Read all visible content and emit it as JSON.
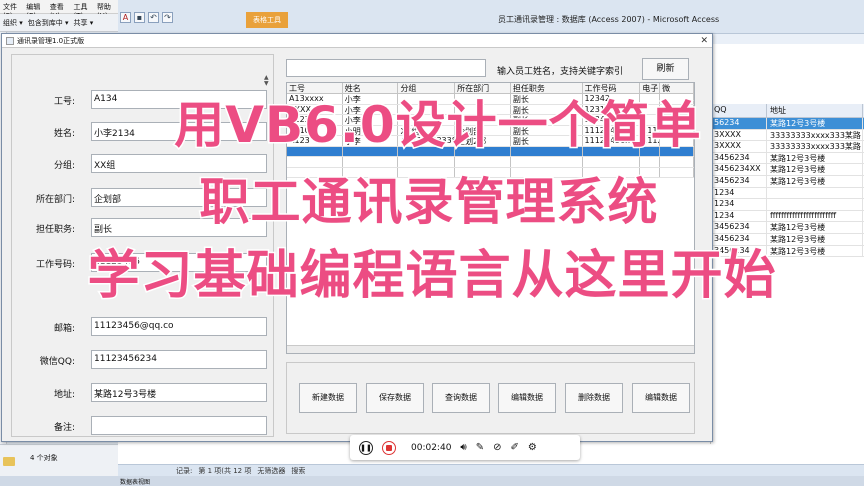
{
  "explorer": {
    "menu": [
      "文件(F)",
      "编辑(E)",
      "查看(V)",
      "工具(T)",
      "帮助(H)"
    ],
    "toolbar": [
      "组织 ▾",
      "包含到库中 ▾",
      "共享 ▾"
    ],
    "status": "4 个对象"
  },
  "access": {
    "window_title": "员工通讯录管理 : 数据库 (Access 2007) - Microsoft Access",
    "context_tab": "表格工具",
    "datasheet": {
      "columns": [
        "QQ",
        "地址"
      ],
      "rows": [
        [
          "56234",
          "某路12号3号楼"
        ],
        [
          "3XXXX",
          "33333333xxxx333某路"
        ],
        [
          "3XXXX",
          "33333333xxxx333某路"
        ],
        [
          "3456234",
          "某路12号3号楼"
        ],
        [
          "3456234XX",
          "某路12号3号楼"
        ],
        [
          "3456234",
          "某路12号3号楼"
        ],
        [
          "1234",
          ""
        ],
        [
          "1234",
          ""
        ],
        [
          "1234",
          "ffffffffffffffffffffffff"
        ],
        [
          "3456234",
          "某路12号3号楼"
        ],
        [
          "3456234",
          "某路12号3号楼"
        ],
        [
          "3456234",
          "某路12号3号楼"
        ]
      ],
      "selected_row": 0
    },
    "record_nav": {
      "label": "记录:",
      "position": "第 1 项(共 12 项",
      "filter": "无筛选器",
      "search": "搜索"
    },
    "status_view": "数据表视图"
  },
  "vb_form": {
    "title": "通讯录管理1.0正式版",
    "fields": [
      {
        "label": "工号:",
        "value": "A134"
      },
      {
        "label": "姓名:",
        "value": "小李2134"
      },
      {
        "label": "分组:",
        "value": "XX组"
      },
      {
        "label": "所在部门:",
        "value": "企划部"
      },
      {
        "label": "担任职务:",
        "value": "副长"
      },
      {
        "label": "工作号码:",
        "value": "11123456"
      },
      {
        "label": "邮箱:",
        "value": "11123456@qq.co"
      },
      {
        "label": "微信QQ:",
        "value": "11123456234"
      },
      {
        "label": "地址:",
        "value": "某路12号3号楼"
      },
      {
        "label": "备注:",
        "value": ""
      }
    ],
    "search_hint": "输入员工姓名，支持关键字索引",
    "search_value": "",
    "refresh_label": "刷新",
    "grid": {
      "columns": [
        "工号",
        "姓名",
        "分组",
        "所在部门",
        "担任职务",
        "工作号码",
        "电子",
        "微"
      ],
      "rows": [
        [
          "A13xxxx",
          "小李",
          "",
          "",
          "副长",
          "12342",
          "",
          ""
        ],
        [
          "XXXX",
          "小李",
          "",
          "",
          "副长",
          "12313",
          "",
          ""
        ],
        [
          "A123",
          "小李",
          "",
          "",
          "副长",
          "12343",
          "",
          ""
        ],
        [
          "A110",
          "小明",
          "XX组",
          "企划部",
          "副长",
          "11123457",
          "1112",
          ""
        ],
        [
          "A123",
          "小李",
          "A2333333338",
          "企划2部",
          "副长",
          "11123456x",
          "1112",
          ""
        ],
        [
          "",
          "",
          "",
          "",
          "",
          "",
          "",
          ""
        ],
        [
          "",
          "",
          "",
          "",
          "",
          "",
          "",
          ""
        ],
        [
          "",
          "",
          "",
          "",
          "",
          "",
          "",
          ""
        ]
      ],
      "selected_row": 5
    },
    "buttons": [
      "新建数据",
      "保存数据",
      "查询数据",
      "编辑数据",
      "删除数据",
      "编辑数据"
    ]
  },
  "overlay": {
    "line1": "用VB6.0设计一个简单",
    "line2": "职工通讯录管理系统",
    "line3": "学习基础编程语言从这里开始"
  },
  "player": {
    "time": "00:02:40",
    "icons": [
      "pause-icon",
      "stop-record-icon",
      "volume-icon",
      "mic-icon",
      "mic-muted-icon",
      "pen-icon",
      "settings-icon"
    ]
  }
}
